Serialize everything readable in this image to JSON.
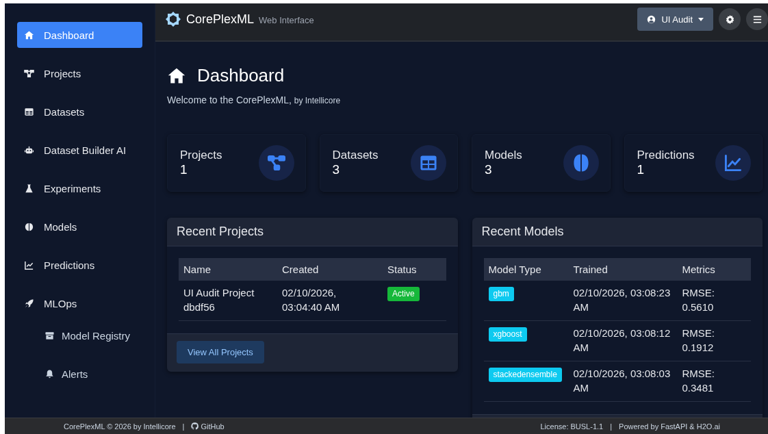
{
  "brand": {
    "name": "CorePlexML",
    "subtitle": "Web Interface"
  },
  "user_menu": {
    "label": "UI Audit"
  },
  "sidebar": {
    "items": [
      {
        "label": "Dashboard",
        "selected": true
      },
      {
        "label": "Projects",
        "selected": false
      },
      {
        "label": "Datasets",
        "selected": false
      },
      {
        "label": "Dataset Builder AI",
        "selected": false
      },
      {
        "label": "Experiments",
        "selected": false
      },
      {
        "label": "Models",
        "selected": false
      },
      {
        "label": "Predictions",
        "selected": false
      },
      {
        "label": "MLOps",
        "selected": false,
        "children": [
          {
            "label": "Model Registry",
            "selected": false
          },
          {
            "label": "Alerts",
            "selected": false
          }
        ]
      }
    ]
  },
  "page": {
    "title": "Dashboard",
    "welcome": "Welcome to the CorePlexML,",
    "byline": "by Intellicore"
  },
  "stats": [
    {
      "label": "Projects",
      "value": "1"
    },
    {
      "label": "Datasets",
      "value": "3"
    },
    {
      "label": "Models",
      "value": "3"
    },
    {
      "label": "Predictions",
      "value": "1"
    }
  ],
  "recent_projects": {
    "title": "Recent Projects",
    "columns": [
      "Name",
      "Created",
      "Status"
    ],
    "rows": [
      {
        "name": "UI Audit Project dbdf56",
        "created": "02/10/2026, 03:04:40 AM",
        "status": "Active"
      }
    ],
    "button": "View All Projects"
  },
  "recent_models": {
    "title": "Recent Models",
    "columns": [
      "Model Type",
      "Trained",
      "Metrics"
    ],
    "rows": [
      {
        "type": "gbm",
        "trained": "02/10/2026, 03:08:23 AM",
        "metrics": "RMSE: 0.5610"
      },
      {
        "type": "xgboost",
        "trained": "02/10/2026, 03:08:12 AM",
        "metrics": "RMSE: 0.1912"
      },
      {
        "type": "stackedensemble",
        "trained": "02/10/2026, 03:08:03 AM",
        "metrics": "RMSE: 0.3481"
      }
    ]
  },
  "footer": {
    "copyright": "CorePlexML © 2026  by Intellicore",
    "separator_left": "|",
    "github": "GitHub",
    "license": "License: BUSL-1.1",
    "separator_right": "|",
    "powered": "Powered by  FastAPI & H2O.ai"
  }
}
